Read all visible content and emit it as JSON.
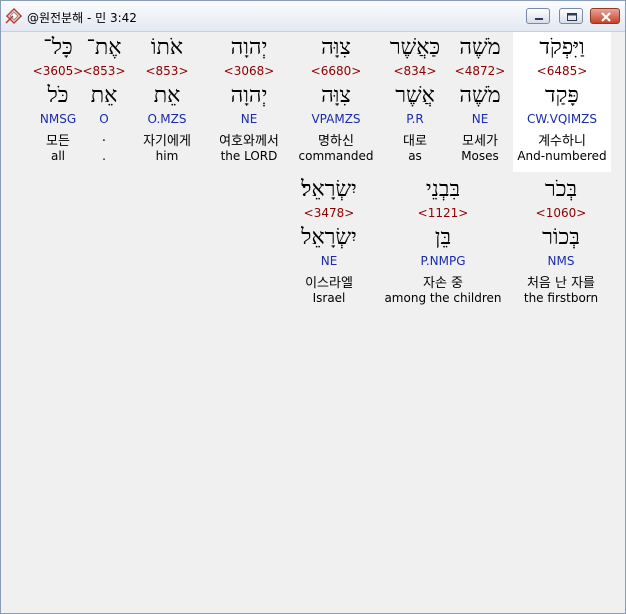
{
  "window": {
    "title": "@원전분해 - 민 3:42",
    "icon": "app-logo-icon",
    "controls": [
      "minimize-icon",
      "maximize-icon",
      "close-icon"
    ]
  },
  "row1": [
    {
      "heb": "כָּל־",
      "strong": "<3605>",
      "lemma": "כֹּל",
      "morph": "NMSG",
      "ko": "모든",
      "en": "all"
    },
    {
      "heb": "אֶת־",
      "strong": "<853>",
      "lemma": "אֵת",
      "morph": "O",
      "ko": ".",
      "en": "."
    },
    {
      "heb": "אֹתוֹ",
      "strong": "<853>",
      "lemma": "אֵת",
      "morph": "O.MZS",
      "ko": "자기에게",
      "en": "him"
    },
    {
      "heb": "יְהוָה",
      "strong": "<3068>",
      "lemma": "יְהוָה",
      "morph": "NE",
      "ko": "여호와께서",
      "en": "the LORD"
    },
    {
      "heb": "צִוָּה",
      "strong": "<6680>",
      "lemma": "צִוָּה",
      "morph": "VPAMZS",
      "ko": "명하신",
      "en": "commanded"
    },
    {
      "heb": "כַּאֲשֶׁר",
      "strong": "<834>",
      "lemma": "אֲשֶׁר",
      "morph": "P.R",
      "ko": "대로",
      "en": "as"
    },
    {
      "heb": "מֹשֶׁה",
      "strong": "<4872>",
      "lemma": "מֹשֶׁה",
      "morph": "NE",
      "ko": "모세가",
      "en": "Moses"
    },
    {
      "heb": "וַיִּפְקֹד",
      "strong": "<6485>",
      "lemma": "פָּקַד",
      "morph": "CW.VQIMZS",
      "ko": "계수하니",
      "en": "And-numbered"
    }
  ],
  "row2": [
    {
      "heb": "יִשְׂרָאֵל׃",
      "strong": "<3478>",
      "lemma": "יִשְׂרָאֵל",
      "morph": "NE",
      "ko": "이스라엘",
      "en": "Israel"
    },
    {
      "heb": "בִּבְנֵי",
      "strong": "<1121>",
      "lemma": "בֵּן",
      "morph": "P.NMPG",
      "ko": "자손 중",
      "en": "among the children"
    },
    {
      "heb": "בְּכֹר",
      "strong": "<1060>",
      "lemma": "בְּכוֹר",
      "morph": "NMS",
      "ko": "처음 난 자를",
      "en": "the firstborn"
    }
  ],
  "colors": {
    "strong": "#8b0000",
    "morph": "#1a2ca8",
    "selected_bg": "#ffffff",
    "background": "#f0f0f0"
  }
}
